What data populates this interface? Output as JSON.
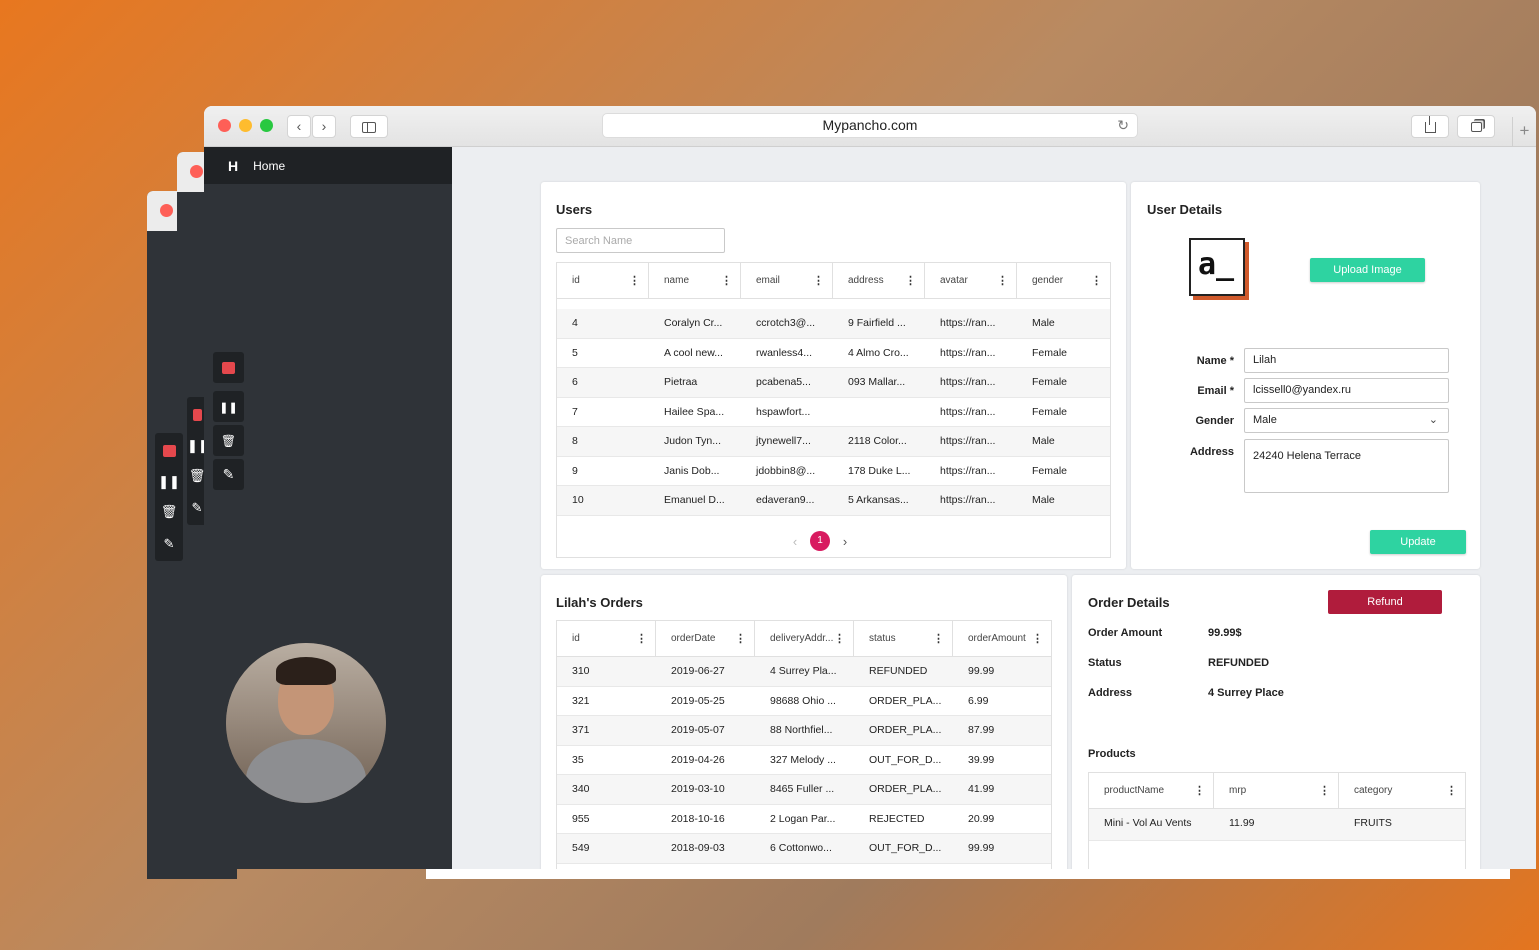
{
  "browser": {
    "url": "Mypancho.com",
    "nav_back": "‹",
    "nav_forward": "›",
    "reload": "↻",
    "new_tab": "+"
  },
  "sidebar": {
    "logo": "H",
    "home_label": "Home"
  },
  "recorder": {
    "pause": "❚❚",
    "trash": "🗑",
    "draw": "✎"
  },
  "users": {
    "title": "Users",
    "search_placeholder": "Search Name",
    "columns": [
      "id",
      "name",
      "email",
      "address",
      "avatar",
      "gender"
    ],
    "rows": [
      [
        "4",
        "Coralyn Cr...",
        "ccrotch3@...",
        "9 Fairfield ...",
        "https://ran...",
        "Male"
      ],
      [
        "5",
        "A cool new...",
        "rwanless4...",
        "4 Almo Cro...",
        "https://ran...",
        "Female"
      ],
      [
        "6",
        "Pietraa",
        "pcabena5...",
        "093 Mallar...",
        "https://ran...",
        "Female"
      ],
      [
        "7",
        "Hailee Spa...",
        "hspawfort...",
        "",
        "https://ran...",
        "Female"
      ],
      [
        "8",
        "Judon Tyn...",
        "jtynewell7...",
        "2118 Color...",
        "https://ran...",
        "Male"
      ],
      [
        "9",
        "Janis Dob...",
        "jdobbin8@...",
        "178 Duke L...",
        "https://ran...",
        "Female"
      ],
      [
        "10",
        "Emanuel D...",
        "edaveran9...",
        "5 Arkansas...",
        "https://ran...",
        "Male"
      ]
    ],
    "pager": {
      "prev": "‹",
      "page": "1",
      "next": "›"
    }
  },
  "user_details": {
    "title": "User Details",
    "avatar_text": "a_",
    "upload_label": "Upload Image",
    "name_label": "Name *",
    "name_value": "Lilah",
    "email_label": "Email *",
    "email_value": "lcissell0@yandex.ru",
    "gender_label": "Gender",
    "gender_value": "Male",
    "address_label": "Address",
    "address_value": "24240 Helena Terrace",
    "update_label": "Update"
  },
  "orders": {
    "title": "Lilah's Orders",
    "columns": [
      "id",
      "orderDate",
      "deliveryAddr...",
      "status",
      "orderAmount"
    ],
    "rows": [
      [
        "310",
        "2019-06-27",
        "4 Surrey Pla...",
        "REFUNDED",
        "99.99"
      ],
      [
        "321",
        "2019-05-25",
        "98688 Ohio ...",
        "ORDER_PLA...",
        "6.99"
      ],
      [
        "371",
        "2019-05-07",
        "88 Northfiel...",
        "ORDER_PLA...",
        "87.99"
      ],
      [
        "35",
        "2019-04-26",
        "327 Melody ...",
        "OUT_FOR_D...",
        "39.99"
      ],
      [
        "340",
        "2019-03-10",
        "8465 Fuller ...",
        "ORDER_PLA...",
        "41.99"
      ],
      [
        "955",
        "2018-10-16",
        "2 Logan Par...",
        "REJECTED",
        "20.99"
      ],
      [
        "549",
        "2018-09-03",
        "6 Cottonwo...",
        "OUT_FOR_D...",
        "99.99"
      ]
    ]
  },
  "order_details": {
    "title": "Order Details",
    "refund_label": "Refund",
    "amount_label": "Order Amount",
    "amount_value": "99.99$",
    "status_label": "Status",
    "status_value": "REFUNDED",
    "address_label": "Address",
    "address_value": "4 Surrey Place",
    "products_title": "Products",
    "product_columns": [
      "productName",
      "mrp",
      "category"
    ],
    "product_rows": [
      [
        "Mini - Vol Au Vents",
        "11.99",
        "FRUITS"
      ]
    ]
  },
  "colors": {
    "accent_green": "#2ed3a1",
    "refund_red": "#b01c3c",
    "page_pink": "#d81b60",
    "sidebar_dark": "#2f3338"
  }
}
